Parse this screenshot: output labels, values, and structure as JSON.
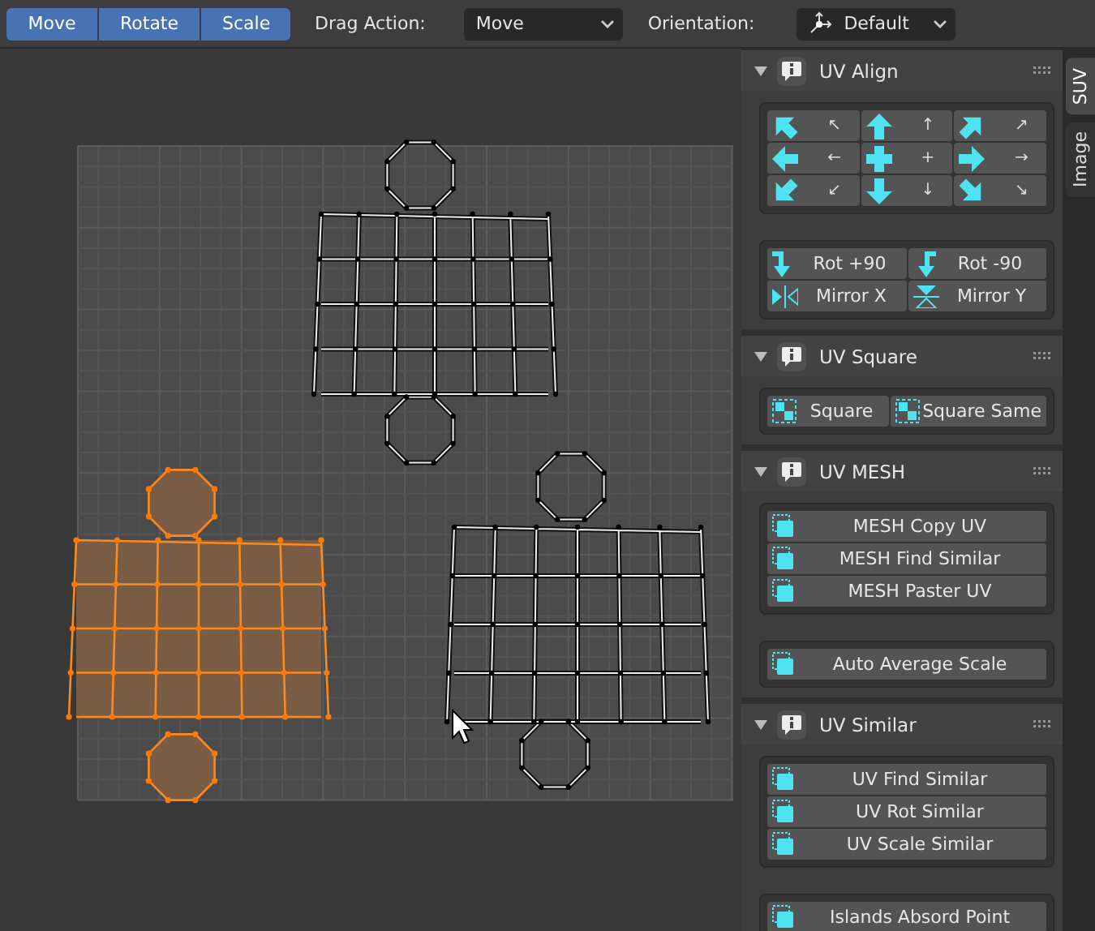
{
  "toolbar": {
    "tools": [
      {
        "label": "Move",
        "selected": true
      },
      {
        "label": "Rotate",
        "selected": true
      },
      {
        "label": "Scale",
        "selected": true
      }
    ],
    "drag_action": {
      "label": "Drag Action:",
      "value": "Move"
    },
    "orientation": {
      "label": "Orientation:",
      "value": "Default"
    }
  },
  "viewport": {
    "islands": [
      {
        "selected": false
      },
      {
        "selected": true
      },
      {
        "selected": false
      }
    ]
  },
  "sidebar": {
    "panels": [
      {
        "title": "UV Align",
        "expanded": true,
        "groups": [
          {
            "kind": "arrow_grid",
            "items": [
              {
                "glyph": "↖"
              },
              {
                "glyph": "↑"
              },
              {
                "glyph": "↗"
              },
              {
                "glyph": "←"
              },
              {
                "glyph": "+"
              },
              {
                "glyph": "→"
              },
              {
                "glyph": "↙"
              },
              {
                "glyph": "↓"
              },
              {
                "glyph": "↘"
              }
            ]
          },
          {
            "kind": "pairs",
            "items": [
              {
                "label": "Rot +90"
              },
              {
                "label": "Rot -90"
              },
              {
                "label": "Mirror X"
              },
              {
                "label": "Mirror Y"
              }
            ]
          }
        ]
      },
      {
        "title": "UV Square",
        "expanded": true,
        "groups": [
          {
            "kind": "row",
            "items": [
              {
                "label": "Square"
              },
              {
                "label": "Square Same"
              }
            ]
          }
        ]
      },
      {
        "title": "UV MESH",
        "expanded": true,
        "groups": [
          {
            "kind": "stack",
            "items": [
              {
                "label": "MESH Copy UV"
              },
              {
                "label": "MESH Find Similar"
              },
              {
                "label": "MESH Paster UV"
              }
            ]
          },
          {
            "kind": "stack",
            "items": [
              {
                "label": "Auto Average Scale"
              }
            ]
          }
        ]
      },
      {
        "title": "UV Similar",
        "expanded": true,
        "groups": [
          {
            "kind": "stack",
            "items": [
              {
                "label": "UV Find Similar"
              },
              {
                "label": "UV Rot Similar"
              },
              {
                "label": "UV Scale Similar"
              }
            ]
          },
          {
            "kind": "stack",
            "items": [
              {
                "label": "Islands Absord Point"
              }
            ]
          }
        ]
      }
    ],
    "tabs": [
      {
        "label": "SUV",
        "selected": true
      },
      {
        "label": "Image",
        "selected": false
      }
    ]
  }
}
